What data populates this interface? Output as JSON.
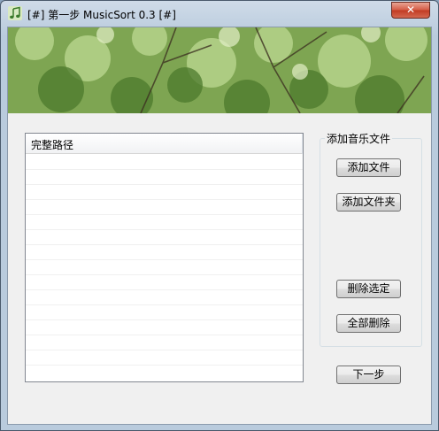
{
  "window": {
    "title": "[#] 第一步 MusicSort 0.3 [#]",
    "close_symbol": "✕",
    "app_icon": "music-note-icon"
  },
  "list": {
    "column_header": "完整路径",
    "rows": []
  },
  "group": {
    "label": "添加音乐文件"
  },
  "buttons": {
    "add_file": "添加文件",
    "add_folder": "添加文件夹",
    "delete_selected": "删除选定",
    "delete_all": "全部删除",
    "next_step": "下一步"
  },
  "colors": {
    "close_button": "#c13a22",
    "titlebar": "#cfdbe8",
    "client_background": "#f0f0f0"
  }
}
